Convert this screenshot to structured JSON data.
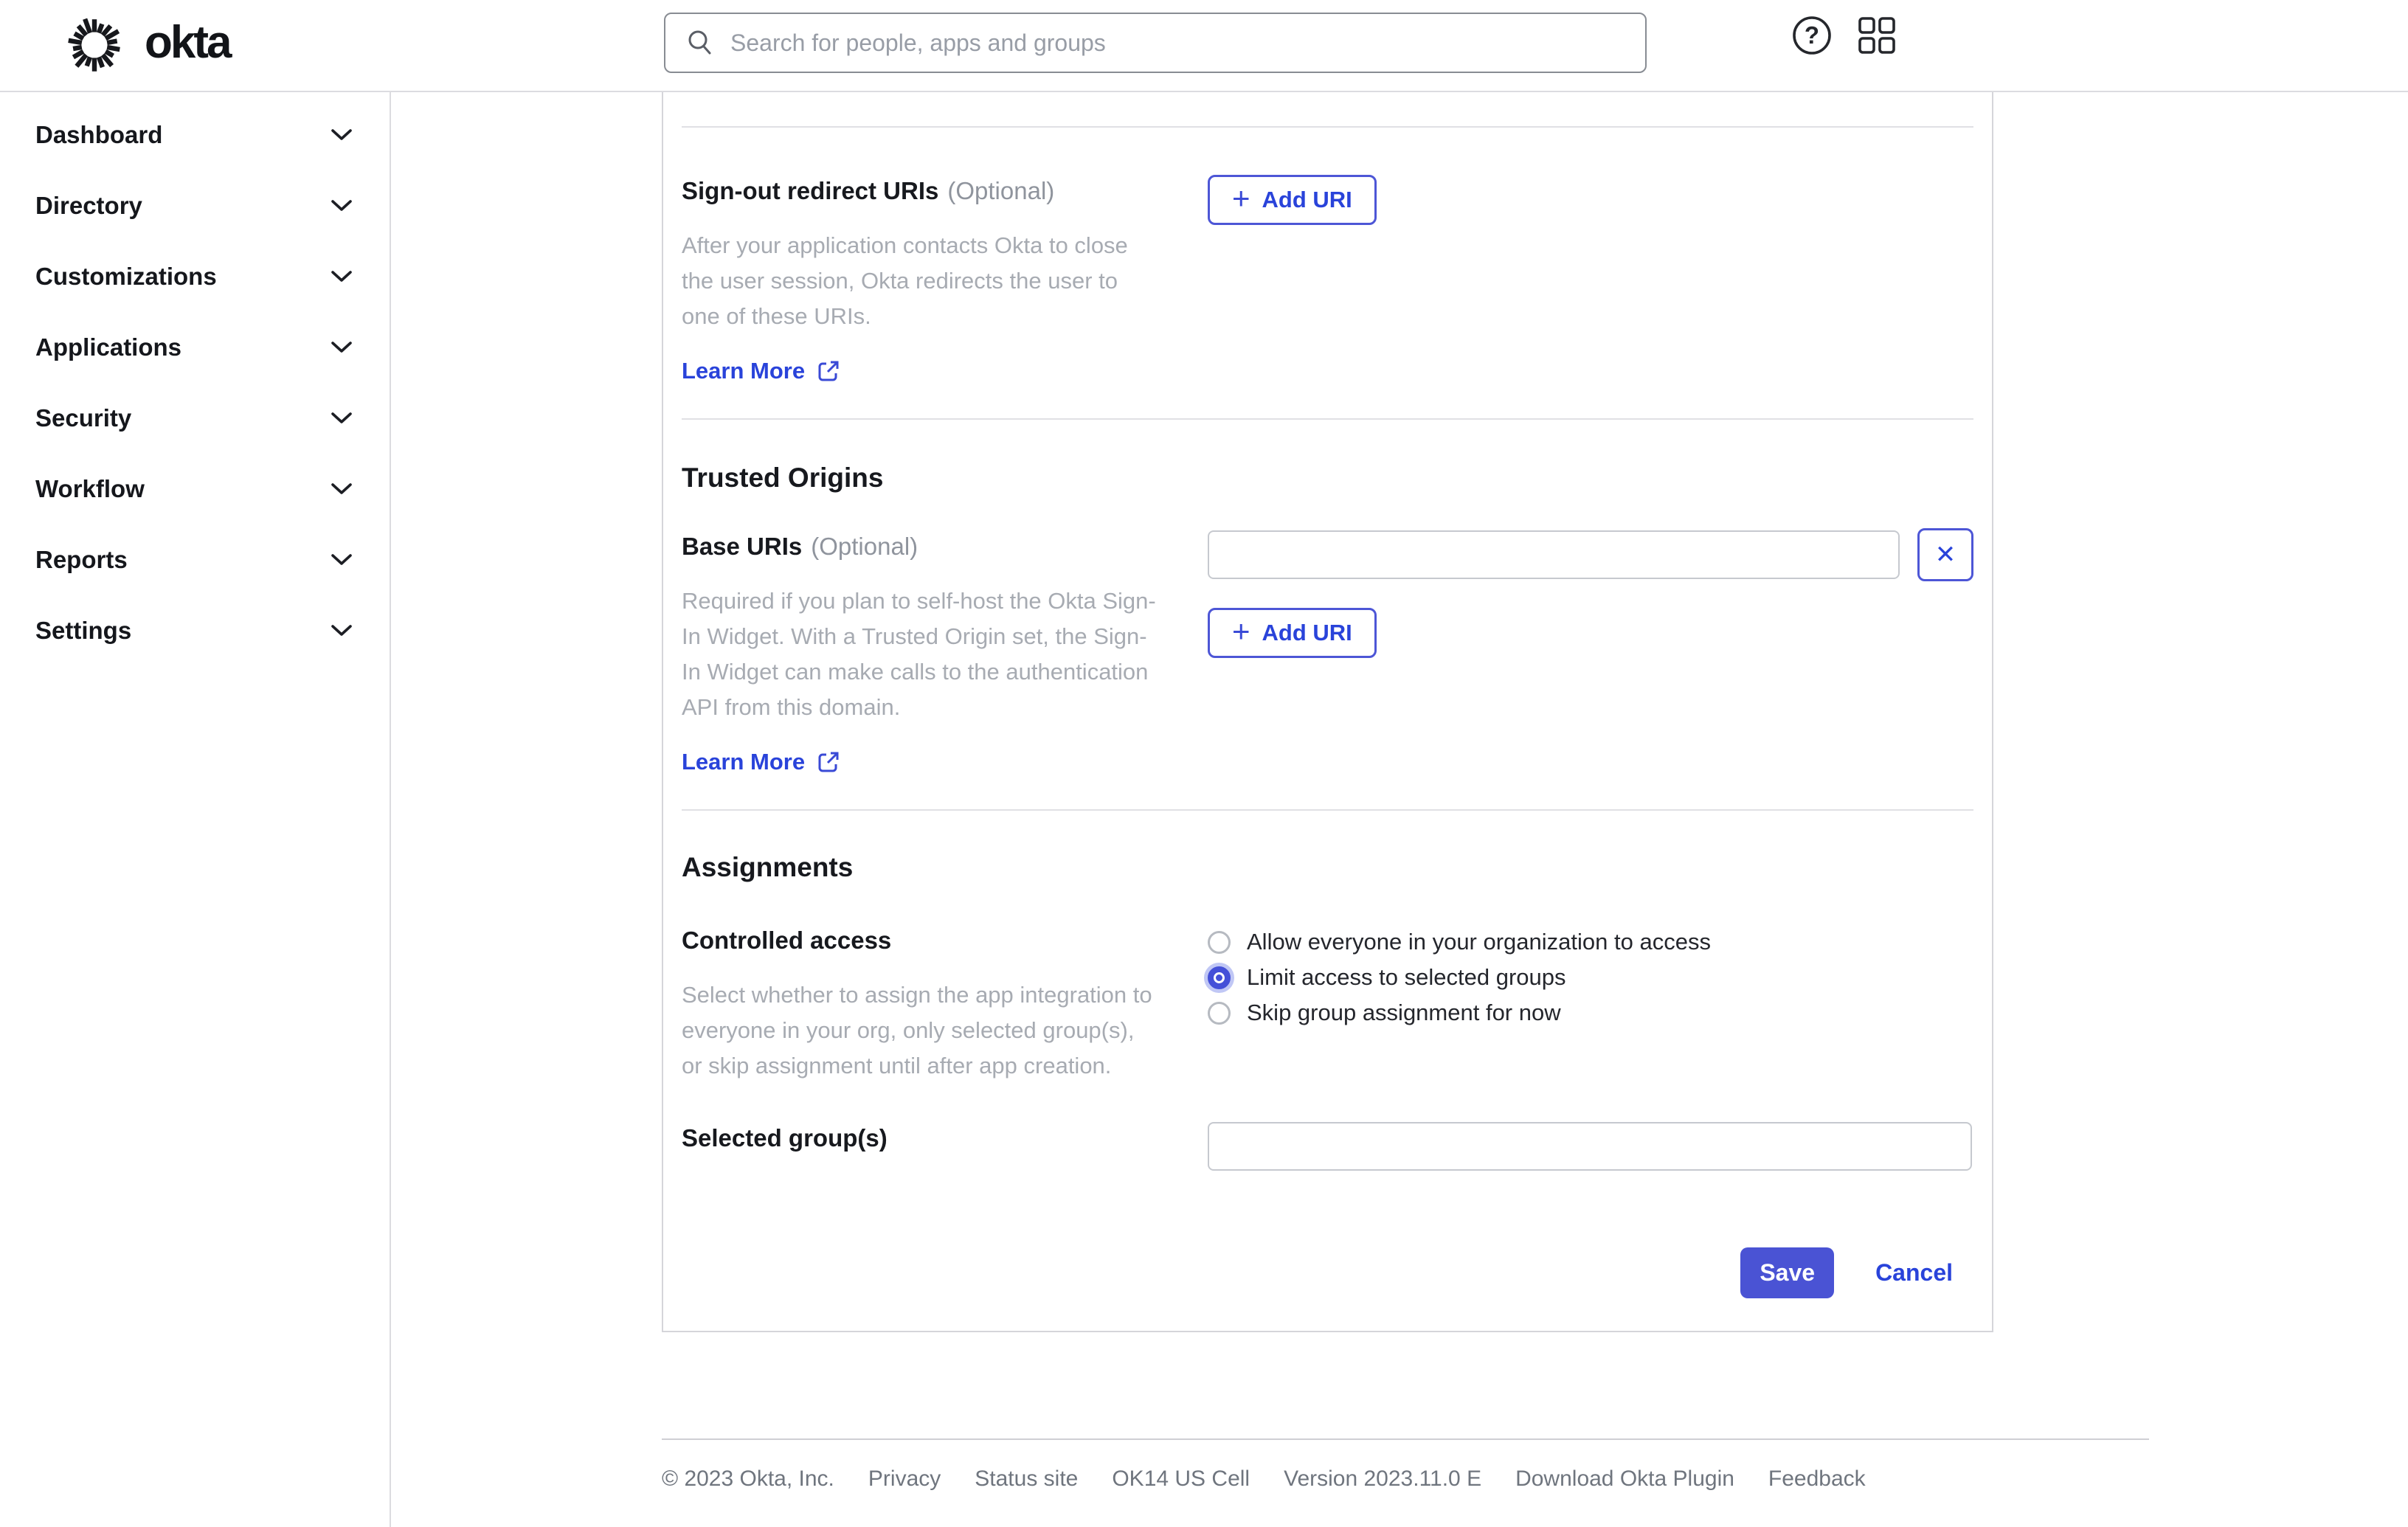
{
  "header": {
    "logo_text": "okta",
    "search_placeholder": "Search for people, apps and groups"
  },
  "sidebar": {
    "items": [
      {
        "label": "Dashboard"
      },
      {
        "label": "Directory"
      },
      {
        "label": "Customizations"
      },
      {
        "label": "Applications"
      },
      {
        "label": "Security"
      },
      {
        "label": "Workflow"
      },
      {
        "label": "Reports"
      },
      {
        "label": "Settings"
      }
    ]
  },
  "panel": {
    "signout": {
      "label": "Sign-out redirect URIs",
      "optional": "(Optional)",
      "description": "After your application contacts Okta to close the user session, Okta redirects the user to one of these URIs.",
      "learn_more": "Learn More",
      "add_uri": "Add URI"
    },
    "trusted_origins": {
      "heading": "Trusted Origins",
      "base_uris_label": "Base URIs",
      "optional": "(Optional)",
      "description": "Required if you plan to self-host the Okta Sign-In Widget. With a Trusted Origin set, the Sign-In Widget can make calls to the authentication API from this domain.",
      "input_value": "",
      "learn_more": "Learn More",
      "add_uri": "Add URI"
    },
    "assignments": {
      "heading": "Assignments",
      "controlled_access_label": "Controlled access",
      "description": "Select whether to assign the app integration to everyone in your org, only selected group(s), or skip assignment until after app creation.",
      "options": [
        {
          "label": "Allow everyone in your organization to access",
          "selected": false
        },
        {
          "label": "Limit access to selected groups",
          "selected": true
        },
        {
          "label": "Skip group assignment for now",
          "selected": false
        }
      ],
      "selected_groups_label": "Selected group(s)",
      "selected_groups_value": ""
    },
    "actions": {
      "save": "Save",
      "cancel": "Cancel"
    }
  },
  "footer": {
    "items": [
      "© 2023 Okta, Inc.",
      "Privacy",
      "Status site",
      "OK14 US Cell",
      "Version 2023.11.0 E",
      "Download Okta Plugin",
      "Feedback"
    ]
  },
  "icons": {
    "plus": "+",
    "close": "✕",
    "help": "?"
  },
  "colors": {
    "accent": "#4a53d4",
    "link": "#2943da",
    "radio": "#4450d8"
  }
}
